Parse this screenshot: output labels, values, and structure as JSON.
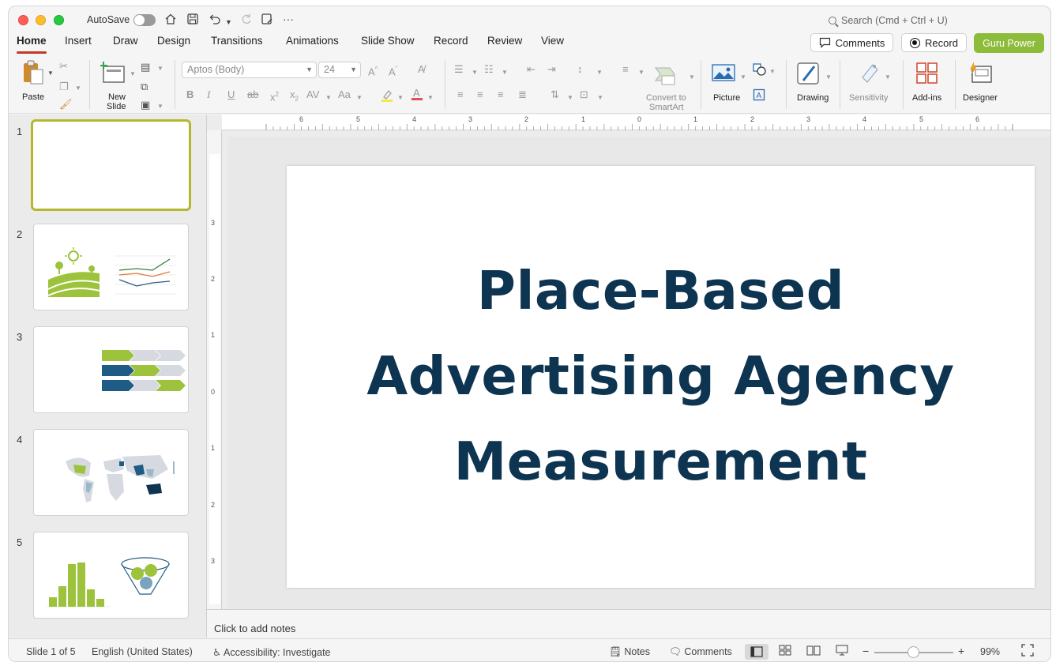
{
  "titlebar": {
    "autosave_label": "AutoSave",
    "search_placeholder": "Search (Cmd + Ctrl + U)"
  },
  "menu": {
    "tabs": [
      "Home",
      "Insert",
      "Draw",
      "Design",
      "Transitions",
      "Animations",
      "Slide Show",
      "Record",
      "Review",
      "View"
    ],
    "active_tab": "Home",
    "comments_label": "Comments",
    "record_label": "Record",
    "guru_label": "Guru Power"
  },
  "ribbon": {
    "paste_label": "Paste",
    "new_slide_label_1": "New",
    "new_slide_label_2": "Slide",
    "font_name": "Aptos (Body)",
    "font_size": "24",
    "convert_label_1": "Convert to",
    "convert_label_2": "SmartArt",
    "picture_label": "Picture",
    "drawing_label": "Drawing",
    "sensitivity_label": "Sensitivity",
    "addins_label": "Add-ins",
    "designer_label": "Designer"
  },
  "thumbnails": [
    {
      "number": "1",
      "selected": true
    },
    {
      "number": "2",
      "selected": false
    },
    {
      "number": "3",
      "selected": false
    },
    {
      "number": "4",
      "selected": false
    },
    {
      "number": "5",
      "selected": false
    }
  ],
  "ruler": {
    "h_ticks": [
      "6",
      "5",
      "4",
      "3",
      "2",
      "1",
      "0",
      "1",
      "2",
      "3",
      "4",
      "5",
      "6"
    ],
    "v_ticks": [
      "3",
      "2",
      "1",
      "0",
      "1",
      "2",
      "3"
    ]
  },
  "slide": {
    "title_line_1": "Place-Based",
    "title_line_2": "Advertising Agency",
    "title_line_3": "Measurement",
    "title_color": "#0d3450"
  },
  "notes": {
    "placeholder": "Click to add notes"
  },
  "status": {
    "slide_position": "Slide 1 of 5",
    "language": "English (United States)",
    "accessibility": "Accessibility: Investigate",
    "notes_label": "Notes",
    "comments_label": "Comments",
    "zoom": "99%"
  },
  "colors": {
    "accent_green": "#8dbb3a",
    "navy": "#0d3450",
    "tab_underline": "#c0392b"
  }
}
